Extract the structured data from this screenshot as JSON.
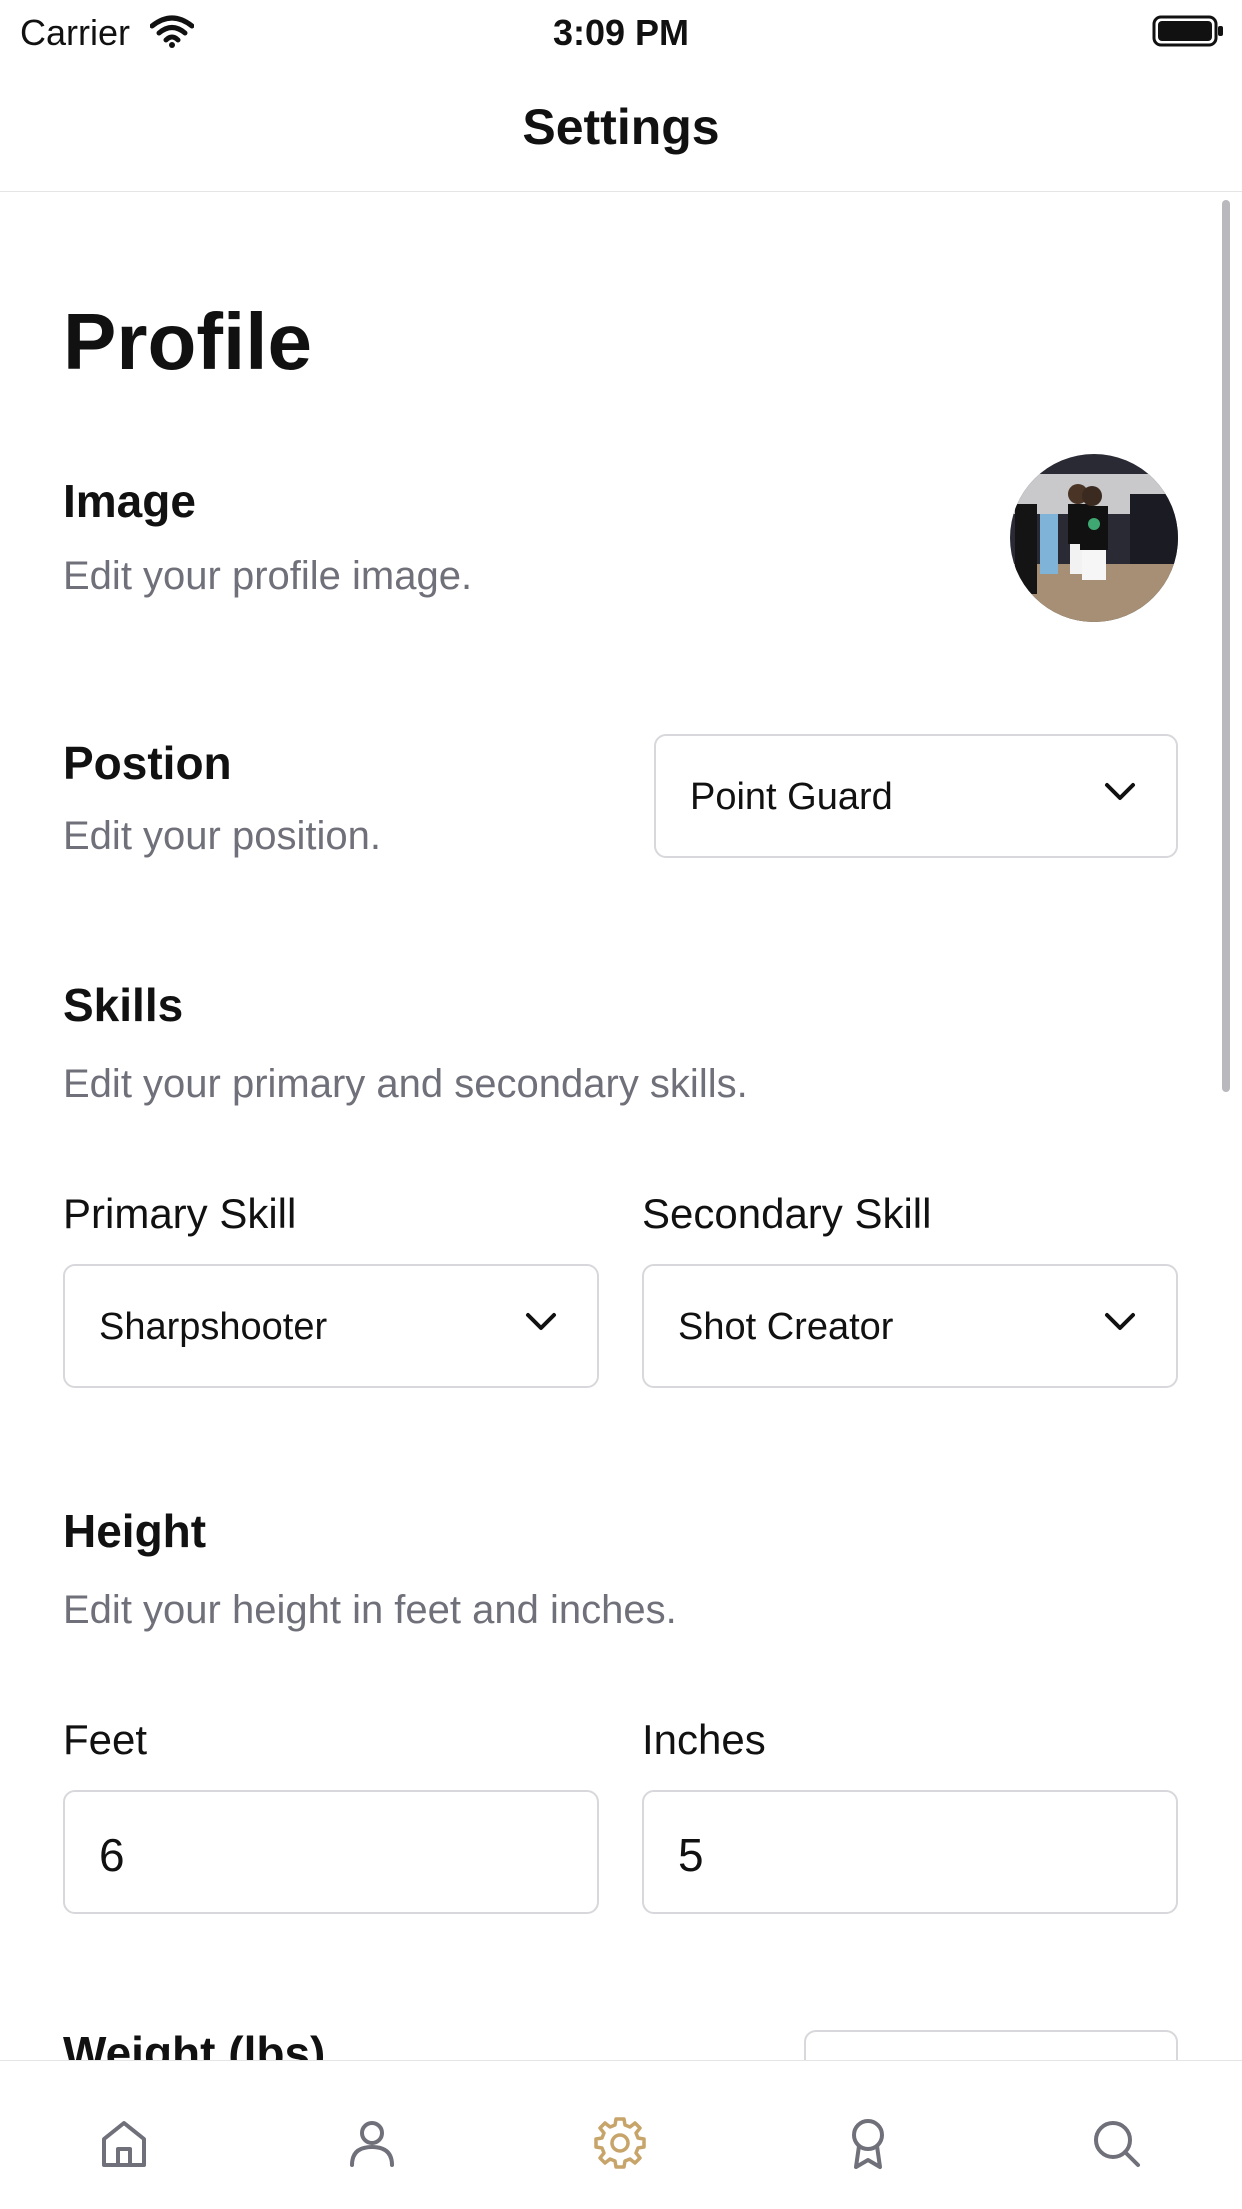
{
  "status_bar": {
    "carrier": "Carrier",
    "time": "3:09 PM"
  },
  "nav": {
    "title": "Settings"
  },
  "profile": {
    "heading": "Profile",
    "image": {
      "title": "Image",
      "desc": "Edit your profile image."
    },
    "position": {
      "title": "Postion",
      "desc": "Edit your position.",
      "value": "Point Guard"
    },
    "skills": {
      "title": "Skills",
      "desc": "Edit your primary and secondary skills.",
      "primary_label": "Primary Skill",
      "primary_value": "Sharpshooter",
      "secondary_label": "Secondary Skill",
      "secondary_value": "Shot Creator"
    },
    "height": {
      "title": "Height",
      "desc": "Edit your height in feet and inches.",
      "feet_label": "Feet",
      "feet_value": "6",
      "inches_label": "Inches",
      "inches_value": "5"
    },
    "weight": {
      "title": "Weight (lbs)"
    }
  },
  "tabbar": {
    "items": [
      {
        "icon": "home-icon"
      },
      {
        "icon": "person-icon"
      },
      {
        "icon": "gear-icon"
      },
      {
        "icon": "award-icon"
      },
      {
        "icon": "search-icon"
      }
    ],
    "active_color": "#c7a46a",
    "inactive_color": "#6f7079"
  }
}
